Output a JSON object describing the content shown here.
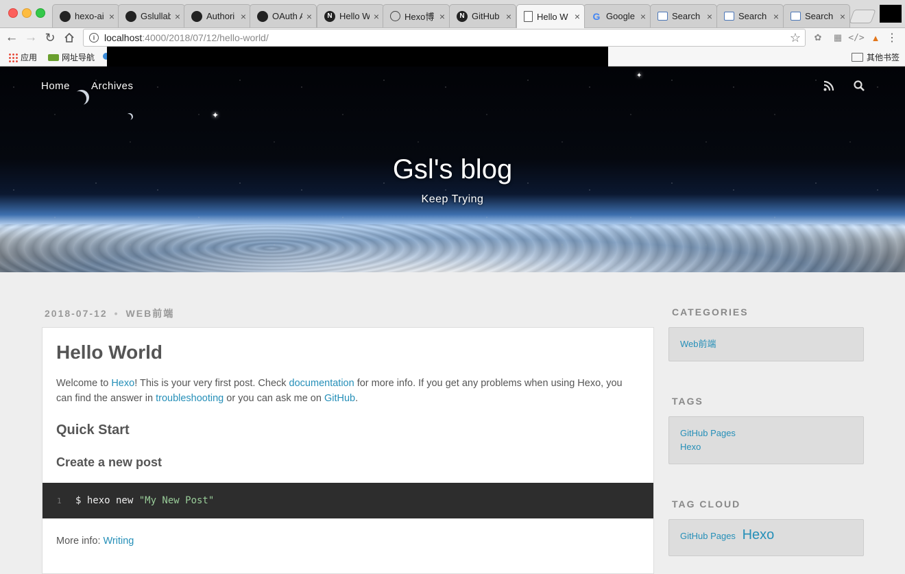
{
  "browser": {
    "tabs": [
      {
        "icon": "github-icon",
        "label": "hexo-ai"
      },
      {
        "icon": "github-icon",
        "label": "Gslullab"
      },
      {
        "icon": "github-icon",
        "label": "Authori"
      },
      {
        "icon": "github-icon",
        "label": "OAuth A"
      },
      {
        "icon": "n-icon",
        "label": "Hello W"
      },
      {
        "icon": "globe-icon",
        "label": "Hexo博"
      },
      {
        "icon": "n-icon",
        "label": "GitHub"
      },
      {
        "icon": "document-icon",
        "label": "Hello W"
      },
      {
        "icon": "google-icon",
        "label": "Google"
      },
      {
        "icon": "search-page-icon",
        "label": "Search"
      },
      {
        "icon": "search-page-icon",
        "label": "Search"
      },
      {
        "icon": "search-page-icon",
        "label": "Search"
      }
    ],
    "url_host": "localhost",
    "url_path": ":4000/2018/07/12/hello-world/",
    "bookmarks": {
      "apps": "应用",
      "nav": "网址导航",
      "other": "其他书签"
    }
  },
  "site": {
    "nav": {
      "home": "Home",
      "archives": "Archives"
    },
    "title": "Gsl's blog",
    "subtitle": "Keep Trying"
  },
  "post": {
    "date": "2018-07-12",
    "category": "WEB前端",
    "title": "Hello World",
    "intro": {
      "t1": "Welcome to ",
      "hexo": "Hexo",
      "t2": "! This is your very first post. Check ",
      "documentation": "documentation",
      "t3": " for more info. If you get any problems when using Hexo, you can find the answer in ",
      "troubleshooting": "troubleshooting",
      "t4": " or you can ask me on ",
      "github": "GitHub",
      "t5": "."
    },
    "h2": "Quick Start",
    "h3": "Create a new post",
    "code": {
      "line": "1",
      "cmd": "$ hexo new ",
      "str": "\"My New Post\""
    },
    "more_label": "More info: ",
    "more_link": "Writing"
  },
  "sidebar": {
    "categories_title": "CATEGORIES",
    "categories": [
      "Web前端"
    ],
    "tags_title": "TAGS",
    "tags": [
      "GitHub Pages",
      "Hexo"
    ],
    "tagcloud_title": "TAG CLOUD",
    "tagcloud": [
      {
        "label": "GitHub Pages"
      },
      {
        "label": "Hexo"
      }
    ]
  },
  "colors": {
    "link": "#258fb8",
    "code_bg": "#2d2d2d",
    "code_string": "#99cc99",
    "page_bg": "#eeeeee"
  }
}
